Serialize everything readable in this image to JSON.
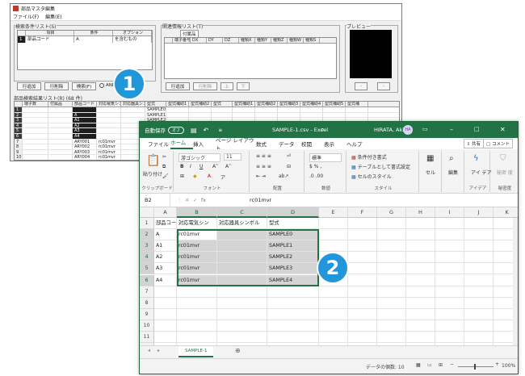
{
  "win1": {
    "title": "部品マスタ編集",
    "menu": [
      "ファイル(F)",
      "編集(E)"
    ],
    "search_group": "検索条件リスト(S)",
    "cond_headers": [
      "項目",
      "条件",
      "オプション"
    ],
    "cond_row": {
      "num": "1",
      "item": "部品コード",
      "cond": "A",
      "option": "を含むもの"
    },
    "btn_add_row": "行追加",
    "btn_del_row": "行削除",
    "btn_search": "検索(F)",
    "radio_and": "AND",
    "related_group": "関連情報リスト(T)",
    "related_tab": "付属品",
    "related_headers": [
      "端子番号",
      "DX",
      "DY",
      "DZ",
      "種類X",
      "種類Y",
      "種類Z",
      "種類W",
      "種類S"
    ],
    "btn_add_row2": "行追加",
    "btn_del_row2": "行削除",
    "btn_up": "上",
    "btn_down": "下",
    "preview_label": "プレビュー",
    "result_group": "部品検索結果リスト(R) (68 件)",
    "result_headers": [
      "端子数",
      "付属品",
      "部品コード",
      "対応電気シンボル",
      "対応器具シンボル",
      "型式",
      "型式補助1",
      "型式補助2",
      "型式",
      "型式補助1",
      "型式補助2",
      "型式補助3",
      "型式補助4",
      "型式補助5",
      "型式補"
    ],
    "result_rows": [
      {
        "n": "1",
        "code": "",
        "sym": "",
        "model": "SAMPLE0",
        "dark": true
      },
      {
        "n": "2",
        "code": "A",
        "sym": "",
        "model": "SAMPLE1",
        "dark": true
      },
      {
        "n": "3",
        "code": "A1",
        "sym": "",
        "model": "SAMPLE2",
        "dark": true
      },
      {
        "n": "4",
        "code": "A2",
        "sym": "",
        "model": "",
        "dark": true
      },
      {
        "n": "5",
        "code": "A3",
        "sym": "",
        "model": "",
        "dark": true
      },
      {
        "n": "6",
        "code": "A4",
        "sym": "",
        "model": "",
        "dark": true
      },
      {
        "n": "7",
        "code": "ARY001",
        "sym": "rc01mvr",
        "model": "",
        "dark": false
      },
      {
        "n": "8",
        "code": "ARY002",
        "sym": "rc01mvr",
        "model": "",
        "dark": false
      },
      {
        "n": "9",
        "code": "ARY003",
        "sym": "rc01mvr",
        "model": "",
        "dark": false
      },
      {
        "n": "10",
        "code": "ARY004",
        "sym": "rc01mvr",
        "model": "",
        "dark": false
      },
      {
        "n": "11",
        "code": "ARY005",
        "sym": "rc01mvr",
        "model": "",
        "dark": false
      }
    ]
  },
  "excel": {
    "autosave": "自動保存",
    "autosave_state": "オフ",
    "doc_name": "SAMPLE-1.csv - Excel",
    "user": "HIRATA, Akio",
    "user_initials": "HA",
    "tabs": [
      "ファイル",
      "ホーム",
      "挿入",
      "ページ レイアウト",
      "数式",
      "データ",
      "校閲",
      "表示",
      "ヘルプ"
    ],
    "share": "共有",
    "comment": "コメント",
    "ribbon": {
      "paste": "貼り付け",
      "clipboard": "クリップボード",
      "font_name": "游ゴシック",
      "font_size": "11",
      "font": "フォント",
      "align": "配置",
      "number_format": "標準",
      "number": "数値",
      "cond_format": "条件付き書式",
      "table_format": "テーブルとして書式設定",
      "cell_style": "セルのスタイル",
      "style": "スタイル",
      "cells": "セル",
      "edit": "編集",
      "ideas": "アイデア",
      "ideas_label": "アイ デア",
      "sensitivity": "秘密度",
      "sensitivity_label": "秘密 度"
    },
    "name_box": "B2",
    "fx": "fx",
    "formula_value": "rc01mvr",
    "columns": [
      "A",
      "B",
      "C",
      "D",
      "E",
      "F",
      "G",
      "H",
      "I",
      "J",
      "K"
    ],
    "rows": [
      "1",
      "2",
      "3",
      "4",
      "5",
      "6",
      "7",
      "8",
      "9",
      "10",
      "11",
      "12",
      "13"
    ],
    "header_row": [
      "部品コード",
      "対応電気シン",
      "対応器具シンボル",
      "型式"
    ],
    "data_rows": [
      [
        "A",
        "rc01mvr",
        "",
        "SAMPLE0"
      ],
      [
        "A1",
        "rc01mvr",
        "",
        "SAMPLE1"
      ],
      [
        "A2",
        "rc01mvr",
        "",
        "SAMPLE2"
      ],
      [
        "A3",
        "rc01mvr",
        "",
        "SAMPLE3"
      ],
      [
        "A4",
        "rc01mvr",
        "",
        "SAMPLE4"
      ]
    ],
    "sheet_tab": "SAMPLE-1",
    "status_count": "データの個数: 10",
    "zoom": "100%"
  },
  "badges": {
    "one": "1",
    "two": "2"
  },
  "colors": {
    "excel_green": "#217346",
    "badge_blue": "#2196d9"
  }
}
